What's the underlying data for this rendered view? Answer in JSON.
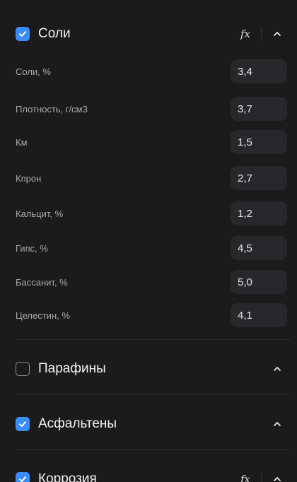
{
  "sections": [
    {
      "title": "Соли",
      "checked": true,
      "has_fx": true,
      "fx_label": "fx"
    },
    {
      "title": "Парафины",
      "checked": false,
      "has_fx": false
    },
    {
      "title": "Асфальтены",
      "checked": true,
      "has_fx": false
    },
    {
      "title": "Коррозия",
      "checked": true,
      "has_fx": true,
      "fx_label": "fx"
    }
  ],
  "soli_rows": [
    {
      "label": "Соли, %",
      "value": "3,4"
    },
    {
      "label": "Плотность, г/см3",
      "value": "3,7"
    },
    {
      "label": "Км",
      "value": "1,5"
    },
    {
      "label": "Кпрон",
      "value": "2,7"
    },
    {
      "label": "Кальцит, %",
      "value": "1,2"
    },
    {
      "label": "Гипс, %",
      "value": "4,5"
    },
    {
      "label": "Бассанит, %",
      "value": "5,0"
    },
    {
      "label": "Целестин, %",
      "value": "4,1"
    }
  ],
  "colors": {
    "background": "#1b1b1d",
    "accent_checkbox": "#3a8df7",
    "input_background": "#28282c",
    "label_text": "#a9a9b0"
  },
  "icons": {
    "checkbox_checked": "check-icon",
    "expand_toggle": "chevron-up-icon",
    "formula": "function-icon"
  }
}
